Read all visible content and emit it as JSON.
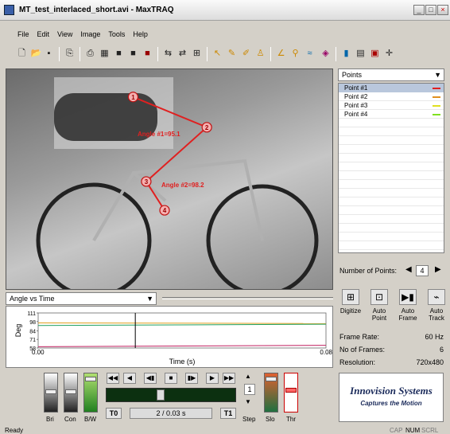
{
  "window": {
    "title": "MT_test_interlaced_short.avi - MaxTRAQ"
  },
  "menu": [
    "File",
    "Edit",
    "View",
    "Image",
    "Tools",
    "Help"
  ],
  "video": {
    "points": [
      {
        "label": "1",
        "x": 0.387,
        "y": 0.125
      },
      {
        "label": "2",
        "x": 0.612,
        "y": 0.262
      },
      {
        "label": "3",
        "x": 0.427,
        "y": 0.507
      },
      {
        "label": "4",
        "x": 0.483,
        "y": 0.637
      }
    ],
    "angle1": "Angle #1=95.1",
    "angle2": "Angle #2=98.2"
  },
  "points_panel": {
    "dropdown": "Points",
    "items": [
      {
        "label": "Point #1",
        "color": "#e02020",
        "selected": true
      },
      {
        "label": "Point #2",
        "color": "#e09020",
        "selected": false
      },
      {
        "label": "Point #3",
        "color": "#e0e020",
        "selected": false
      },
      {
        "label": "Point #4",
        "color": "#80e020",
        "selected": false
      }
    ],
    "num_points_label": "Number of Points:",
    "num_points": "4"
  },
  "actions": [
    {
      "label": "Digitize",
      "icon": "digitize-icon"
    },
    {
      "label": "Auto Point",
      "icon": "auto-point-icon"
    },
    {
      "label": "Auto Frame",
      "icon": "auto-frame-icon"
    },
    {
      "label": "Auto Track",
      "icon": "auto-track-icon"
    }
  ],
  "info": {
    "frame_rate_label": "Frame Rate:",
    "frame_rate": "60 Hz",
    "frames_label": "No of Frames:",
    "frames": "6",
    "resolution_label": "Resolution:",
    "resolution": "720x480"
  },
  "graph_select": "Angle vs Time",
  "chart_data": {
    "type": "line",
    "xlabel": "Time (s)",
    "ylabel": "Deg",
    "xlim": [
      0.0,
      0.08
    ],
    "ylim": [
      58,
      111
    ],
    "x_ticks": [
      "0.00",
      "0.08"
    ],
    "y_ticks": [
      "111",
      "98",
      "84",
      "71",
      "58"
    ],
    "series": [
      {
        "color": "#e0a020",
        "x": [
          0.0,
          0.08
        ],
        "y": [
          96,
          95
        ]
      },
      {
        "color": "#20a060",
        "x": [
          0.0,
          0.08
        ],
        "y": [
          92,
          94
        ]
      },
      {
        "color": "#c02060",
        "x": [
          0.0,
          0.08
        ],
        "y": [
          60,
          62
        ]
      }
    ],
    "cursor_x": 0.027
  },
  "controls": {
    "bri": "Bri",
    "con": "Con",
    "bw": "B/W",
    "t0": "T0",
    "t1": "T1",
    "frame_display": "2 / 0.03 s",
    "step_value": "1",
    "step": "Step",
    "sio": "Slo",
    "thr": "Thr"
  },
  "logo": {
    "line1": "Innovision Systems",
    "line2": "Captures the Motion"
  },
  "status": {
    "text": "Ready",
    "cap": "CAP",
    "num": "NUM",
    "scrl": "SCRL"
  }
}
